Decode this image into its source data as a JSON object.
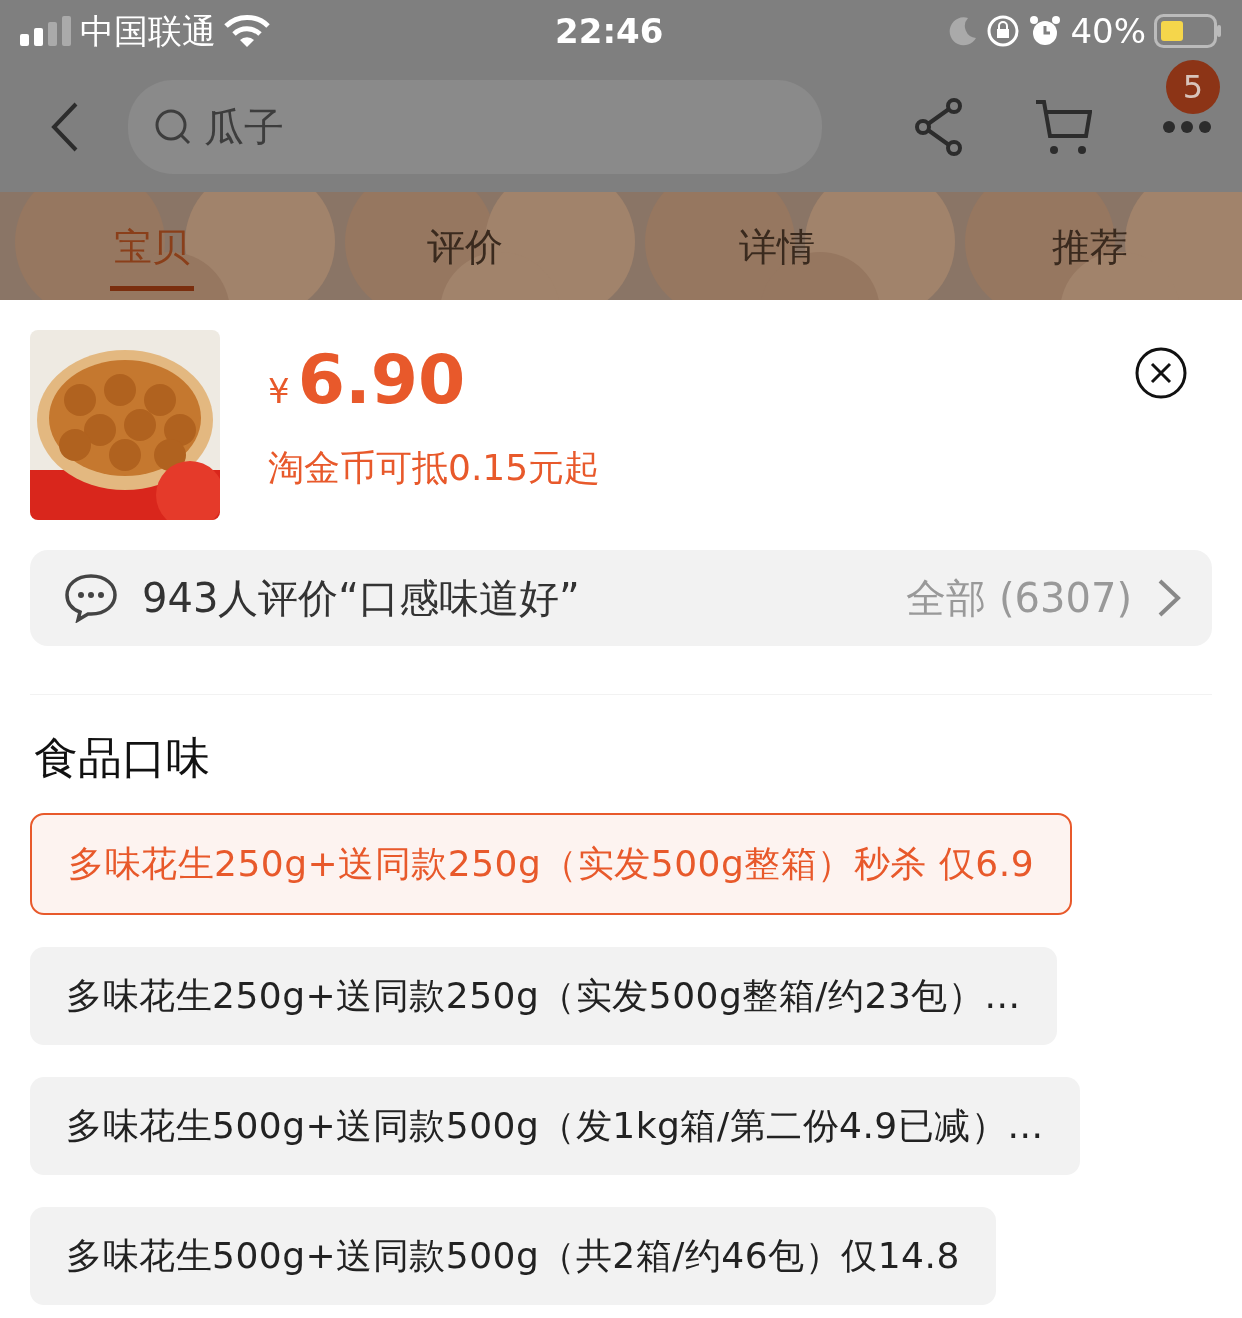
{
  "status_bar": {
    "carrier": "中国联通",
    "time": "22:46",
    "battery": "40%"
  },
  "nav": {
    "search": {
      "placeholder": "瓜子"
    },
    "badge": "5"
  },
  "tabs": [
    {
      "label": "宝贝",
      "selected": true
    },
    {
      "label": "评价",
      "selected": false
    },
    {
      "label": "详情",
      "selected": false
    },
    {
      "label": "推荐",
      "selected": false
    }
  ],
  "product": {
    "currency": "¥",
    "price": "6.90",
    "coin_note": "淘金币可抵0.15元起"
  },
  "review": {
    "summary": "943人评价“口感味道好”",
    "all": "全部 (6307)"
  },
  "spec": {
    "title": "食品口味",
    "options": [
      {
        "label": "多味花生250g+送同款250g（实发500g整箱）秒杀 仅6.9",
        "selected": true
      },
      {
        "label": "多味花生250g+送同款250g（实发500g整箱/约23包）…",
        "selected": false
      },
      {
        "label": "多味花生500g+送同款500g（发1kg箱/第二份4.9已减）…",
        "selected": false
      },
      {
        "label": "多味花生500g+送同款500g（共2箱/约46包）仅14.8",
        "selected": false
      }
    ]
  }
}
